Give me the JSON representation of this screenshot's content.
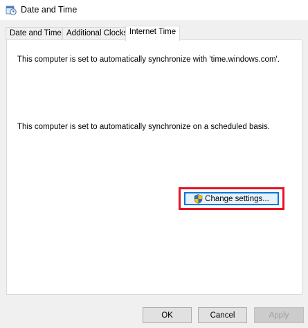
{
  "window": {
    "title": "Date and Time",
    "icon": "clock-globe-icon"
  },
  "tabs": [
    {
      "label": "Date and Time",
      "active": false
    },
    {
      "label": "Additional Clocks",
      "active": false
    },
    {
      "label": "Internet Time",
      "active": true
    }
  ],
  "internet_time": {
    "sync_server_message": "This computer is set to automatically synchronize with 'time.windows.com'.",
    "sync_schedule_message": "This computer is set to automatically synchronize on a scheduled basis.",
    "change_settings_label": "Change settings...",
    "change_settings_icon": "uac-shield-icon",
    "highlight_color": "#e81123"
  },
  "footer": {
    "ok_label": "OK",
    "cancel_label": "Cancel",
    "apply_label": "Apply",
    "apply_enabled": false
  }
}
